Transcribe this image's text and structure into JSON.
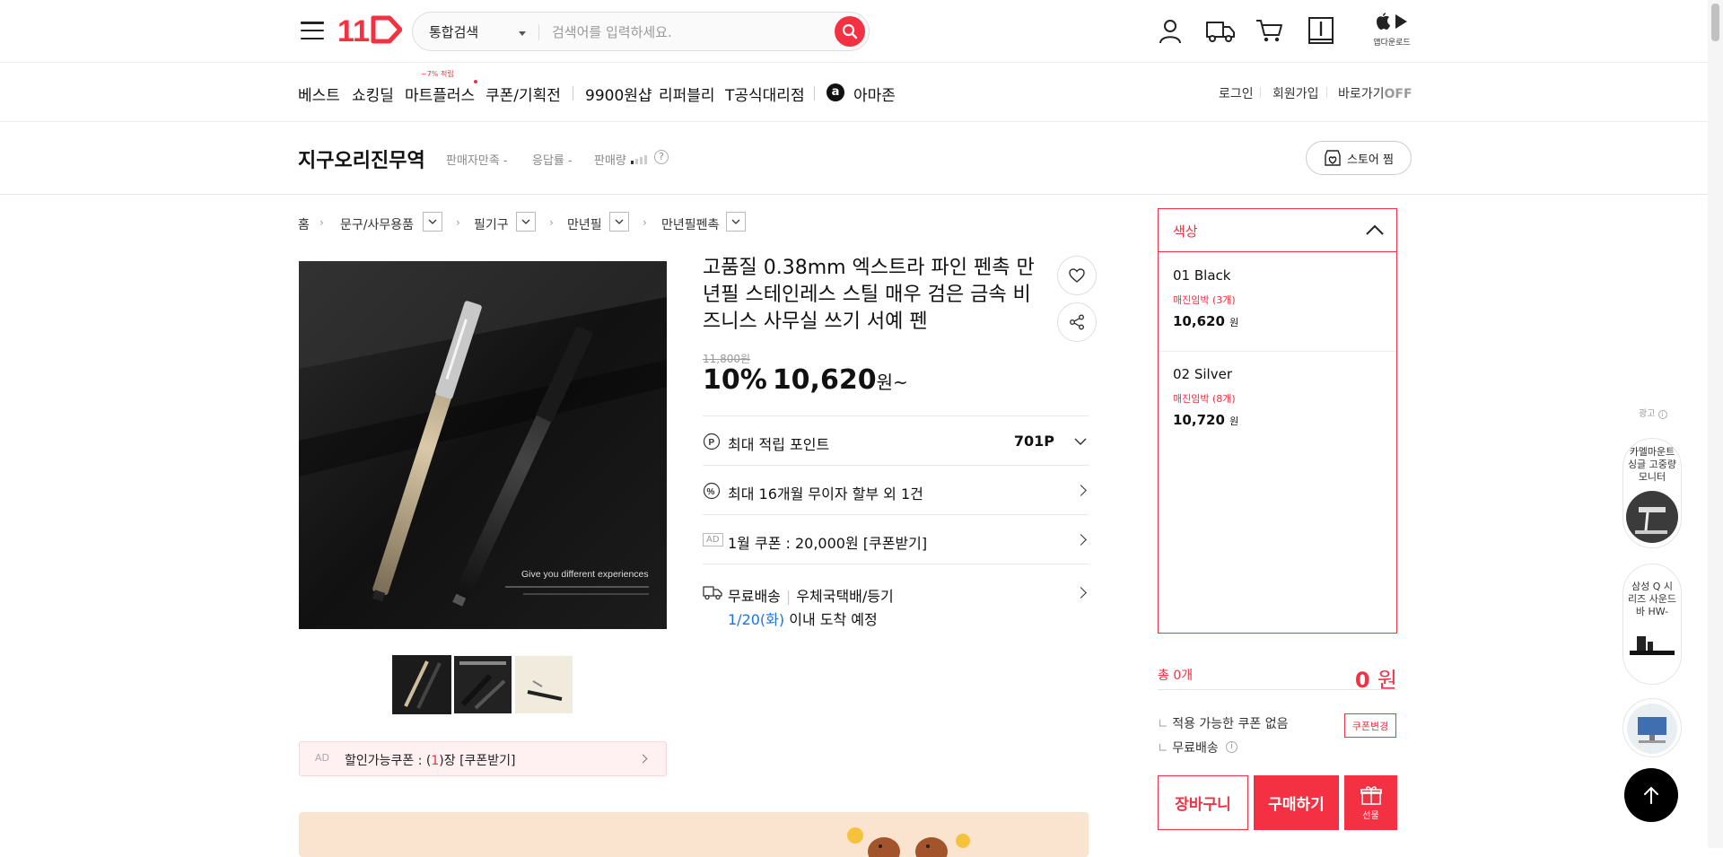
{
  "header": {
    "logo_text": "11번가",
    "search_category": "통합검색",
    "search_placeholder": "검색어를 입력하세요.",
    "app_download_label": "앱다운로드"
  },
  "nav": {
    "items": [
      "베스트",
      "쇼킹딜",
      "마트플러스",
      "쿠폰/기획전",
      "9900원샵",
      "리퍼블리",
      "T공식대리점",
      "아마존"
    ],
    "mart_badge": "~7% 적립",
    "amazon_glyph": "a",
    "login": "로그인",
    "signup": "회원가입",
    "shortcut": "바로가기",
    "shortcut_state": "OFF"
  },
  "store": {
    "name": "지구오리진무역",
    "seller_satisfaction": "판매자만족 -",
    "response_rate": "응답률 -",
    "sales_volume": "판매량",
    "favorite_button": "스토어 찜"
  },
  "breadcrumb": [
    "홈",
    "문구/사무용품",
    "필기구",
    "만년필",
    "만년필펜촉"
  ],
  "product": {
    "title": "고품질 0.38mm 엑스트라 파인 펜촉 만년필 스테인레스 스틸 매우 검은 금속 비즈니스 사무실 쓰기 서예 펜",
    "image_caption": "Give you different experiences",
    "original_price": "11,800원",
    "discount": "10%",
    "price": "10,620",
    "price_unit": "원~",
    "benefits": {
      "points_label": "최대 적립 포인트",
      "points_value": "701P",
      "installment": "최대 16개월 무이자 할부 외 1건",
      "ad_tag": "AD",
      "coupon": "1월 쿠폰 : 20,000원 [쿠폰받기]",
      "shipping_free": "무료배송",
      "shipping_method": "우체국택배/등기",
      "arrival_date": "1/20(화)",
      "arrival_text": "이내 도착 예정"
    },
    "ad_coupon": {
      "tag": "AD",
      "text_before": "할인가능쿠폰 : (",
      "count": "1",
      "text_after": ")장 [쿠폰받기]"
    }
  },
  "options": {
    "header": "색상",
    "items": [
      {
        "name": "01 Black",
        "stock": "매진임박 (3개)",
        "price": "10,620",
        "unit": "원"
      },
      {
        "name": "02 Silver",
        "stock": "매진임박 (8개)",
        "price": "10,720",
        "unit": "원"
      }
    ]
  },
  "order": {
    "total_count": "총 0개",
    "total_price": "0",
    "total_unit": "원",
    "coupon_none": "적용 가능한 쿠폰 없음",
    "coupon_change": "쿠폰변경",
    "free_shipping": "무료배송",
    "cart_button": "장바구니",
    "buy_button": "구매하기",
    "gift_button": "선물"
  },
  "side_ads": {
    "label": "광고",
    "items": [
      "카멜마운트 싱글 고중량 모니터",
      "삼성 Q 시리즈 사운드바 HW-"
    ]
  },
  "colors": {
    "brand_red": "#f43142",
    "link_blue": "#1a73e8"
  }
}
